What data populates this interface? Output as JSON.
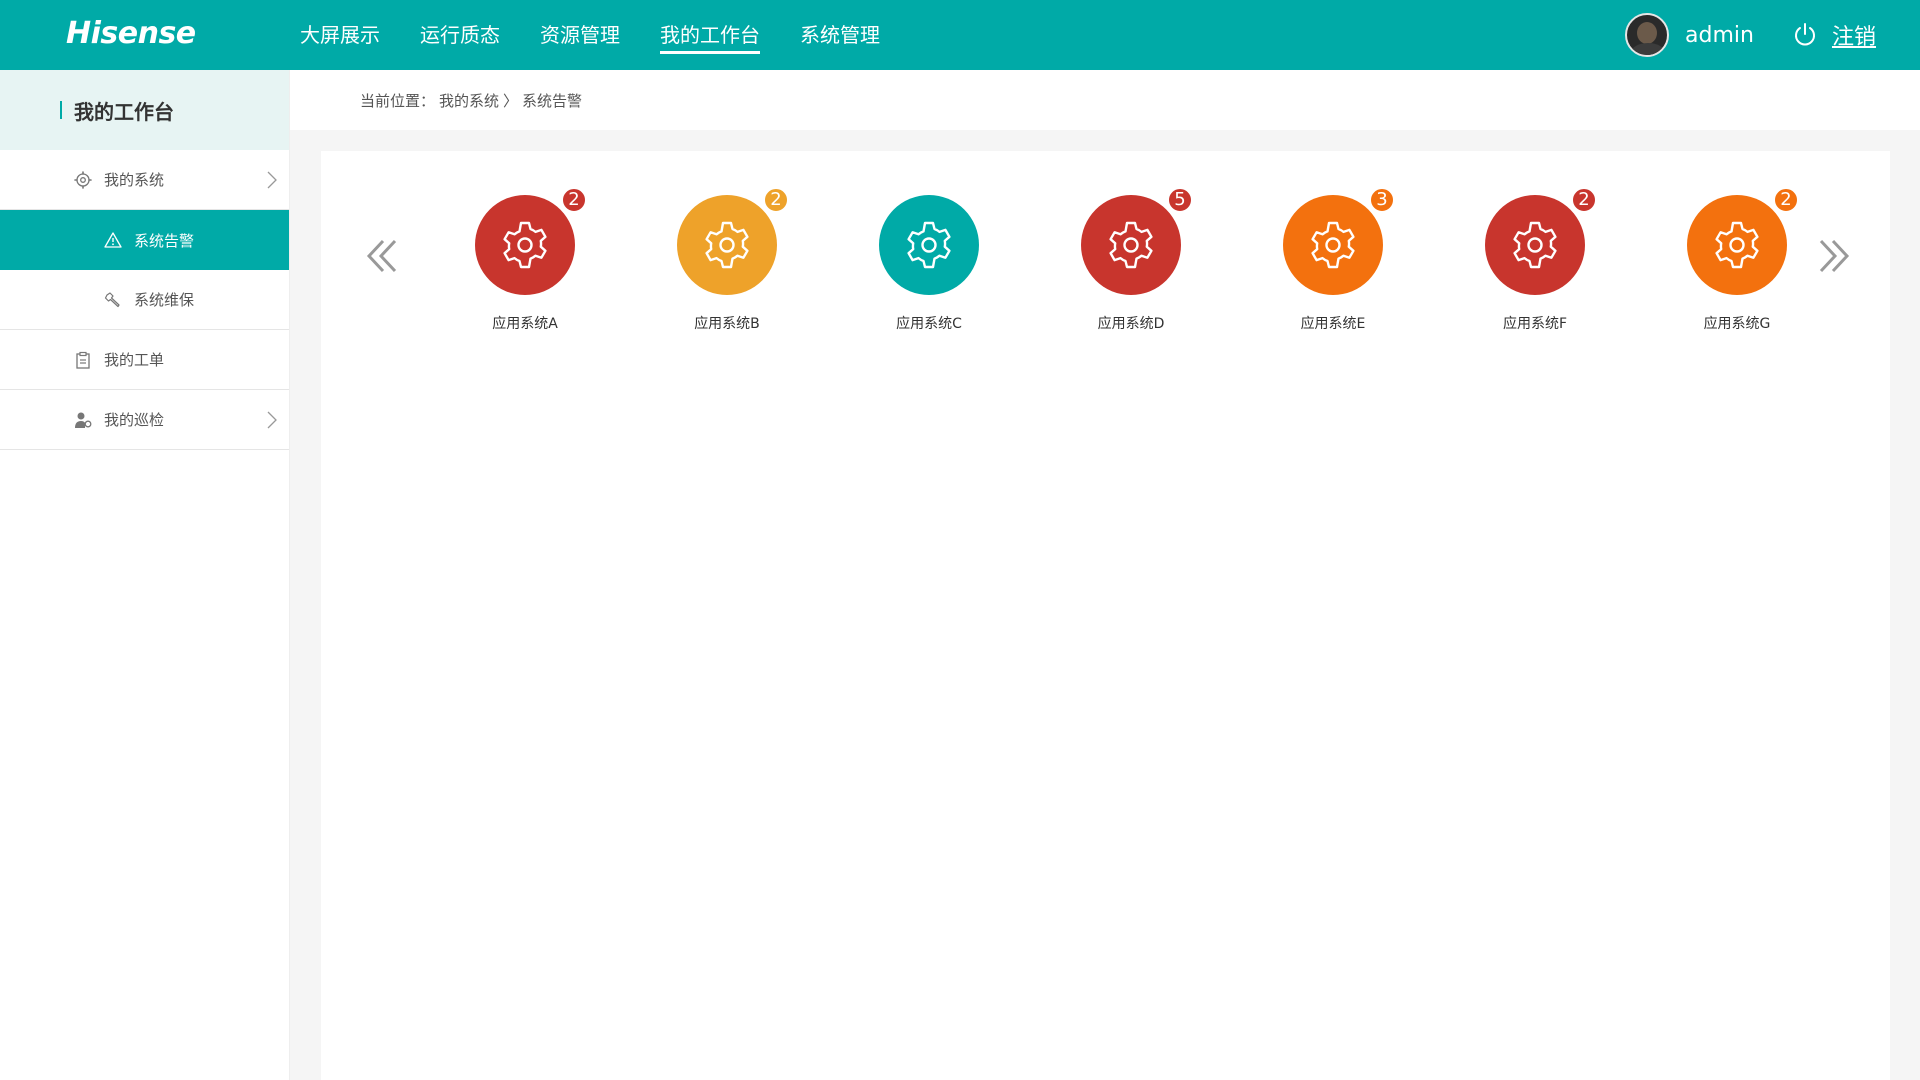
{
  "header": {
    "logo": "Hisense",
    "nav": [
      "大屏展示",
      "运行质态",
      "资源管理",
      "我的工作台",
      "系统管理"
    ],
    "active_nav_index": 3,
    "username": "admin",
    "logout": "注销"
  },
  "sidebar": {
    "title": "我的工作台",
    "items": [
      {
        "label": "我的系统",
        "icon": "gear-icon",
        "expanded": true
      },
      {
        "label": "系统告警",
        "icon": "warning-icon",
        "active": true
      },
      {
        "label": "系统维保",
        "icon": "wrench-icon"
      },
      {
        "label": "我的工单",
        "icon": "clipboard-icon"
      },
      {
        "label": "我的巡检",
        "icon": "inspector-icon"
      }
    ]
  },
  "breadcrumb": {
    "prefix": "当前位置：",
    "path": [
      "我的系统",
      "〉",
      "系统告警"
    ]
  },
  "systems": [
    {
      "name": "应用系统A",
      "count": "2",
      "color": "#c8352d"
    },
    {
      "name": "应用系统B",
      "count": "2",
      "color": "#eea22a"
    },
    {
      "name": "应用系统C",
      "count": "",
      "color": "#00aaa7"
    },
    {
      "name": "应用系统D",
      "count": "5",
      "color": "#c8352d"
    },
    {
      "name": "应用系统E",
      "count": "3",
      "color": "#f3710e"
    },
    {
      "name": "应用系统F",
      "count": "2",
      "color": "#c8352d"
    },
    {
      "name": "应用系统G",
      "count": "2",
      "color": "#f3710e"
    }
  ],
  "colors": {
    "primary": "#00aaa7",
    "danger": "#c8352d",
    "warning": "#eea22a",
    "orange": "#f3710e"
  }
}
